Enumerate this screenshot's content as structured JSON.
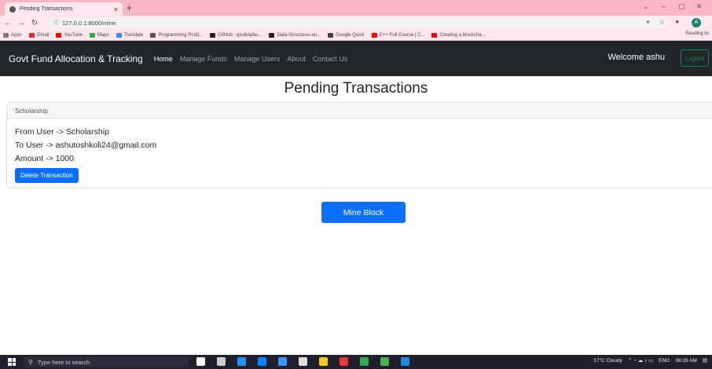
{
  "browser": {
    "tab_title": "Pending Transactions",
    "tab_close": "×",
    "new_tab": "+",
    "url": "127.0.0.1:8000/mine",
    "min": "⌄",
    "minimize": "–",
    "restore": "▢",
    "close": "✕",
    "profile_initial": "A",
    "bookmarks": [
      {
        "label": "Apps",
        "color": "#7a7a7a"
      },
      {
        "label": "Gmail",
        "color": "#d93025"
      },
      {
        "label": "YouTube",
        "color": "#ff0000"
      },
      {
        "label": "Maps",
        "color": "#34a853"
      },
      {
        "label": "Translate",
        "color": "#4285f4"
      },
      {
        "label": "Programming Probl...",
        "color": "#555555"
      },
      {
        "label": "GitHub - qsulbiq/bu...",
        "color": "#222222"
      },
      {
        "label": "Data-Structures-an...",
        "color": "#222222"
      },
      {
        "label": "Google Quick",
        "color": "#444444"
      },
      {
        "label": "C++ Full Course | C...",
        "color": "#ff0000"
      },
      {
        "label": "Creating a blockcha...",
        "color": "#ff0000"
      }
    ],
    "reading_list": "Reading lis"
  },
  "navbar": {
    "brand": "Govt Fund Allocation & Tracking",
    "links": [
      "Home",
      "Manage Funds",
      "Manage Users",
      "About",
      "Contact Us"
    ],
    "welcome": "Welcome ashu",
    "logout": "Logout"
  },
  "main": {
    "title": "Pending Transactions",
    "card": {
      "header": "Scholarship",
      "from": "From User -> Scholarship",
      "to": "To User -> ashutoshkoli24@gmail.com",
      "amount": "Amount -> 1000",
      "delete_label": "Delete Transaction"
    },
    "mine_label": "Mine Block"
  },
  "taskbar": {
    "search_placeholder": "Type here to search",
    "weather": "17°C Cloudy",
    "lang": "ENG",
    "time": "08:28 AM",
    "icon_colors": [
      "#ffffff",
      "#cccccc",
      "#1e90ff",
      "#0a84ff",
      "#3399ff",
      "#dddddd",
      "#f5c518",
      "#e53935",
      "#34a853",
      "#4caf50",
      "#1e88e5"
    ]
  }
}
